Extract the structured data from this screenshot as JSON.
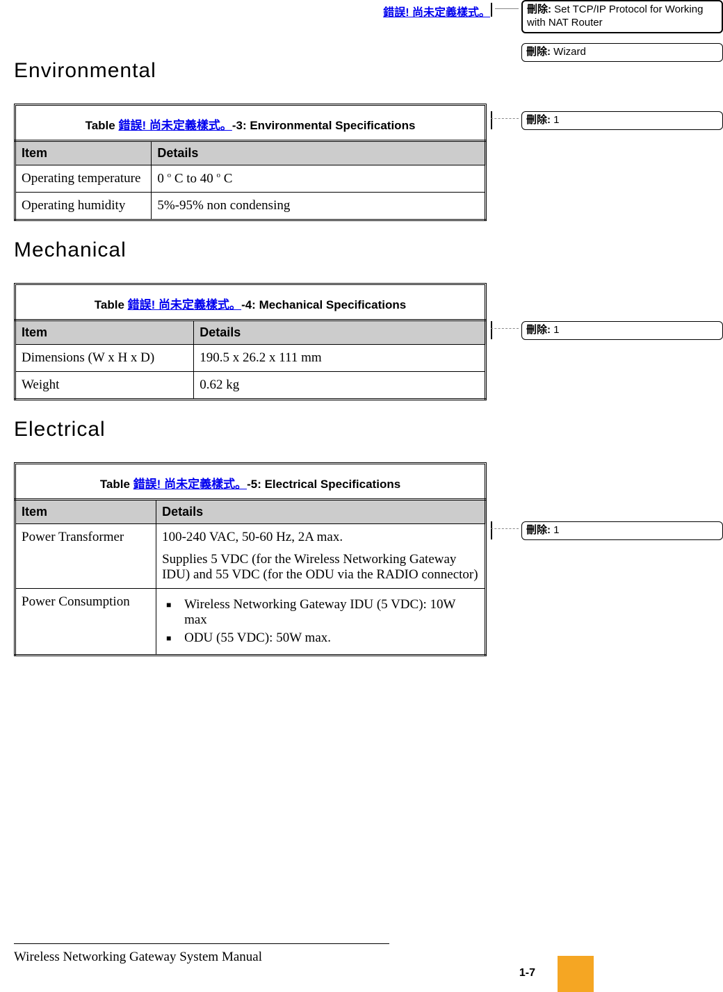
{
  "header": {
    "running_link": "錯誤! 尚未定義樣式。"
  },
  "comments": {
    "c1": {
      "label": "刪除:",
      "text": " Set TCP/IP Protocol for Working with NAT Router"
    },
    "c2": {
      "label": "刪除:",
      "text": " Wizard"
    },
    "c3": {
      "label": "刪除:",
      "text": " 1"
    },
    "c4": {
      "label": "刪除:",
      "text": " 1"
    },
    "c5": {
      "label": "刪除:",
      "text": " 1"
    }
  },
  "sections": {
    "env": {
      "title": "Environmental",
      "table_caption_prefix": "Table ",
      "table_caption_link": "錯誤! 尚未定義樣式。",
      "table_caption_suffix": "-3: Environmental Specifications",
      "col1": "Item",
      "col2": "Details",
      "rows": [
        {
          "item": "Operating temperature",
          "details": "0 ° C to 40 ° C"
        },
        {
          "item": "Operating humidity",
          "details": "5%-95% non condensing"
        }
      ]
    },
    "mech": {
      "title": "Mechanical",
      "table_caption_prefix": "Table ",
      "table_caption_link": "錯誤! 尚未定義樣式。",
      "table_caption_suffix": "-4: Mechanical Specifications",
      "col1": "Item",
      "col2": "Details",
      "rows": [
        {
          "item": "Dimensions (W x H x D)",
          "details": "190.5 x 26.2 x 111 mm"
        },
        {
          "item": "Weight",
          "details": "0.62 kg"
        }
      ]
    },
    "elec": {
      "title": "Electrical",
      "table_caption_prefix": "Table ",
      "table_caption_link": "錯誤! 尚未定義樣式。",
      "table_caption_suffix": "-5: Electrical Specifications",
      "col1": "Item",
      "col2": "Details",
      "row1_item": "Power Transformer",
      "row1_details_a": "100-240 VAC, 50-60 Hz, 2A max.",
      "row1_details_b": "Supplies 5 VDC (for the Wireless Networking Gateway IDU) and 55 VDC (for the ODU via the RADIO connector)",
      "row2_item": "Power Consumption",
      "row2_b1": "Wireless Networking Gateway IDU (5 VDC): 10W max",
      "row2_b2": "ODU (55 VDC): 50W max."
    }
  },
  "footer": {
    "manual_title": "Wireless Networking Gateway System Manual",
    "page_number": "1-7"
  }
}
